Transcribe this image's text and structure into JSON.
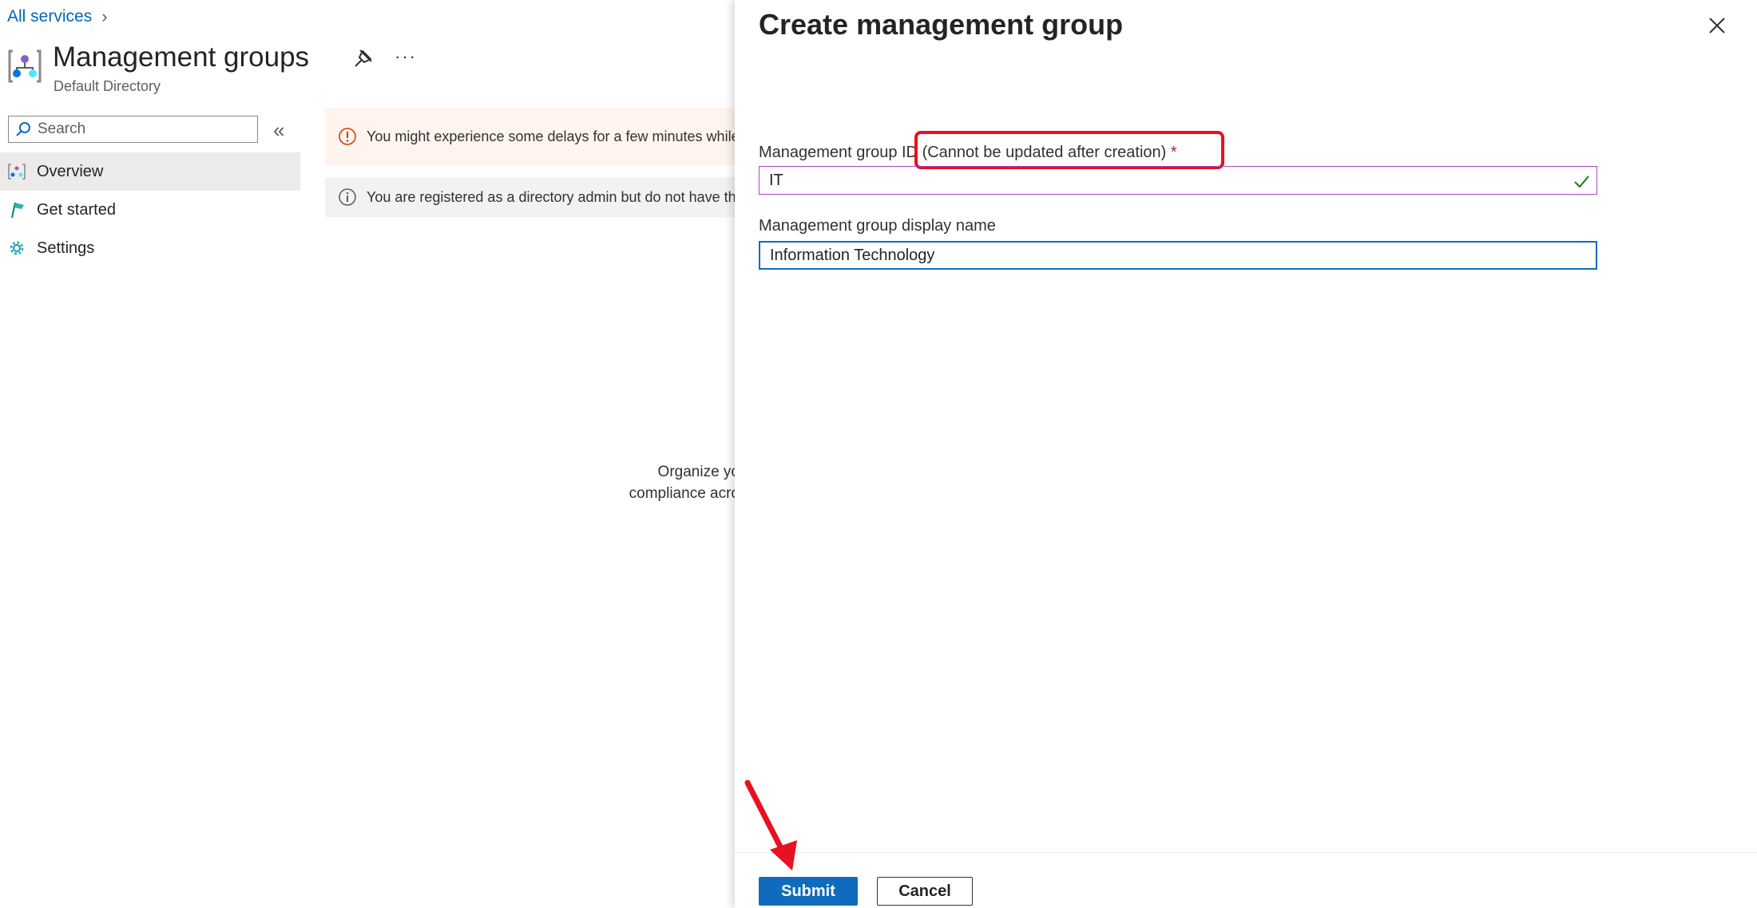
{
  "breadcrumb": {
    "root": "All services",
    "chevron": "›"
  },
  "page": {
    "title": "Management groups",
    "subtitle": "Default Directory",
    "more": "···"
  },
  "search": {
    "placeholder": "Search",
    "value": ""
  },
  "collapse": "«",
  "nav": {
    "items": [
      {
        "label": "Overview",
        "icon": "management-groups-icon",
        "active": true
      },
      {
        "label": "Get started",
        "icon": "flag-icon",
        "active": false
      },
      {
        "label": "Settings",
        "icon": "gear-icon",
        "active": false
      }
    ]
  },
  "banners": {
    "warning": "You might experience some delays for a few minutes while",
    "info": "You are registered as a directory admin but do not have th"
  },
  "empty_state": {
    "line1": "Organize yo",
    "line2": "compliance acro"
  },
  "panel": {
    "title": "Create management group",
    "id_label": "Management group ID",
    "id_note": "(Cannot be updated after creation)",
    "required_mark": "*",
    "id_value": "IT",
    "name_label": "Management group display name",
    "name_value": "Information Technology",
    "submit_label": "Submit",
    "cancel_label": "Cancel"
  },
  "colors": {
    "accent": "#0f6cbd",
    "link": "#0067b8",
    "annotation": "#e8111f",
    "valid": "#107c10",
    "warning": "#d83b01"
  }
}
